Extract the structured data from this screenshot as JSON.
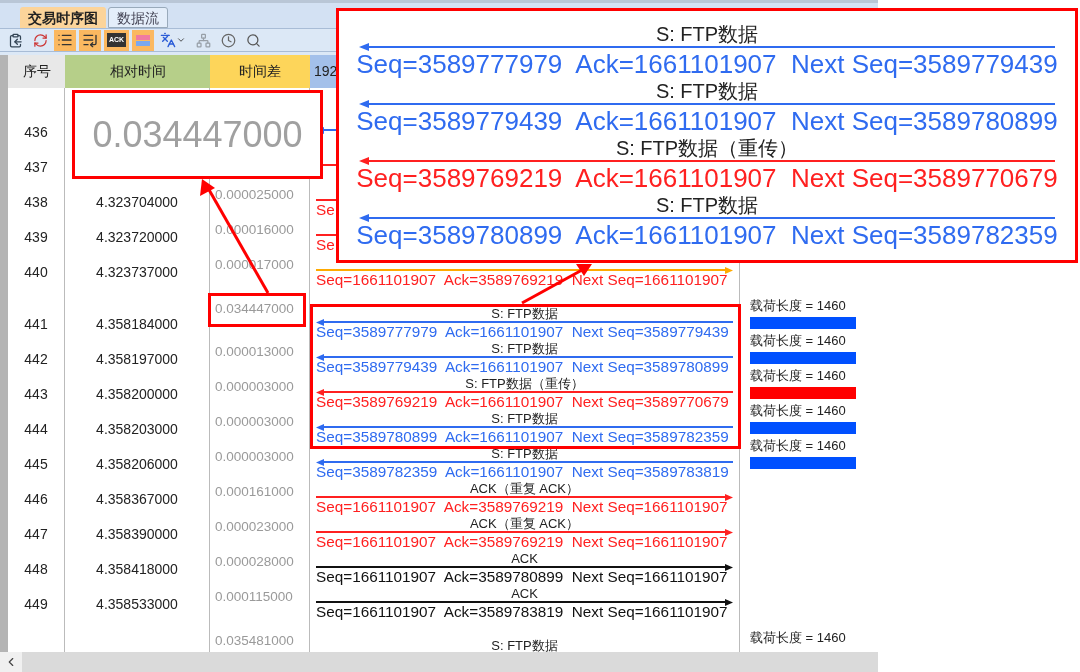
{
  "tabs": [
    {
      "label": "交易时序图",
      "selected": true
    },
    {
      "label": "数据流",
      "selected": false
    }
  ],
  "toolbar": [
    {
      "kind": "copy",
      "on": false,
      "disabled": false
    },
    {
      "kind": "refresh",
      "on": false,
      "disabled": false
    },
    {
      "kind": "list",
      "on": true,
      "disabled": false
    },
    {
      "kind": "list-arrow",
      "on": true,
      "disabled": false
    },
    {
      "kind": "ack",
      "label": "ACK",
      "on": true,
      "disabled": false
    },
    {
      "kind": "color-bars",
      "on": true,
      "disabled": false
    },
    {
      "kind": "language",
      "on": false,
      "disabled": false
    },
    {
      "kind": "tree",
      "on": false,
      "disabled": true
    },
    {
      "kind": "clock",
      "on": false,
      "disabled": false
    },
    {
      "kind": "search",
      "on": false,
      "disabled": false
    }
  ],
  "columns": [
    {
      "label": "序号",
      "color": "#e8e8e8"
    },
    {
      "label": "相对时间",
      "color": "#b6cf89"
    },
    {
      "label": "时间差",
      "color": "#fdd55a"
    },
    {
      "label": "192",
      "color": "#a3c0ea"
    }
  ],
  "rows": [
    {
      "no": "436",
      "flow": {
        "arrow": {
          "kind": "left",
          "color": "#2f6bf0"
        }
      }
    },
    {
      "no": "437",
      "flow": {
        "arrow": {
          "kind": "right",
          "color": "#ff2020"
        }
      }
    },
    {
      "no": "438",
      "time": "4.323704000",
      "delta": "0.000025000",
      "flow": {
        "arrow": {
          "kind": "right",
          "color": "#ff2020"
        },
        "color": "#ff2020",
        "text": "Se"
      }
    },
    {
      "no": "439",
      "time": "4.323720000",
      "delta": "0.000016000",
      "flow": {
        "arrow": {
          "kind": "right",
          "color": "#ff2020"
        },
        "color": "#ff2020",
        "text": "Se"
      }
    },
    {
      "no": "440",
      "time": "4.323737000",
      "delta": "0.000017000",
      "flow": {
        "arrow": {
          "kind": "right",
          "color": "#ffaa00"
        },
        "color": "#ff2020",
        "text": "Seq=1661101907  Ack=3589769219  Next Seq=1661101907"
      }
    },
    {
      "no": "441",
      "time": "4.358184000",
      "delta": "0.034447000",
      "flow": {
        "arrow": {
          "kind": "left",
          "color": "#2f6bf0"
        },
        "color": "#2f6bf0",
        "label": "S: FTP数据",
        "text": "Seq=3589777979  Ack=1661101907  Next Seq=3589779439"
      },
      "payload": {
        "label": "载荷长度 = 1460",
        "color": "#0050ff"
      }
    },
    {
      "no": "442",
      "time": "4.358197000",
      "delta": "0.000013000",
      "flow": {
        "arrow": {
          "kind": "left",
          "color": "#2f6bf0"
        },
        "color": "#2f6bf0",
        "label": "S: FTP数据",
        "text": "Seq=3589779439  Ack=1661101907  Next Seq=3589780899"
      },
      "payload": {
        "label": "载荷长度 = 1460",
        "color": "#0050ff"
      }
    },
    {
      "no": "443",
      "time": "4.358200000",
      "delta": "0.000003000",
      "flow": {
        "arrow": {
          "kind": "left",
          "color": "#ff2020"
        },
        "color": "#ff2020",
        "label": "S: FTP数据（重传）",
        "text": "Seq=3589769219  Ack=1661101907  Next Seq=3589770679"
      },
      "payload": {
        "label": "载荷长度 = 1460",
        "color": "#ff0000"
      }
    },
    {
      "no": "444",
      "time": "4.358203000",
      "delta": "0.000003000",
      "flow": {
        "arrow": {
          "kind": "left",
          "color": "#2f6bf0"
        },
        "color": "#2f6bf0",
        "label": "S: FTP数据",
        "text": "Seq=3589780899  Ack=1661101907  Next Seq=3589782359"
      },
      "payload": {
        "label": "载荷长度 = 1460",
        "color": "#0050ff"
      }
    },
    {
      "no": "445",
      "time": "4.358206000",
      "delta": "0.000003000",
      "flow": {
        "arrow": {
          "kind": "left",
          "color": "#2f6bf0"
        },
        "color": "#2f6bf0",
        "label": "S: FTP数据",
        "text": "Seq=3589782359  Ack=1661101907  Next Seq=3589783819"
      },
      "payload": {
        "label": "载荷长度 = 1460",
        "color": "#0050ff"
      }
    },
    {
      "no": "446",
      "time": "4.358367000",
      "delta": "0.000161000",
      "flow": {
        "arrow": {
          "kind": "right",
          "color": "#ff2020"
        },
        "color": "#ff2020",
        "label": "ACK（重复 ACK）",
        "text": "Seq=1661101907  Ack=3589769219  Next Seq=1661101907"
      }
    },
    {
      "no": "447",
      "time": "4.358390000",
      "delta": "0.000023000",
      "flow": {
        "arrow": {
          "kind": "right",
          "color": "#ff2020"
        },
        "color": "#ff2020",
        "label": "ACK（重复 ACK）",
        "text": "Seq=1661101907  Ack=3589769219  Next Seq=1661101907"
      }
    },
    {
      "no": "448",
      "time": "4.358418000",
      "delta": "0.000028000",
      "flow": {
        "arrow": {
          "kind": "right",
          "color": "#111111"
        },
        "color": "#111111",
        "label": "ACK",
        "text": "Seq=1661101907  Ack=3589780899  Next Seq=1661101907"
      }
    },
    {
      "no": "449",
      "time": "4.358533000",
      "delta": "0.000115000",
      "flow": {
        "arrow": {
          "kind": "right",
          "color": "#111111"
        },
        "color": "#111111",
        "label": "ACK",
        "text": "Seq=1661101907  Ack=3589783819  Next Seq=1661101907"
      }
    },
    {
      "delta": "0.035481000",
      "flow": {
        "label": "S: FTP数据"
      },
      "payload": {
        "label": "载荷长度 = 1460"
      }
    }
  ],
  "delta_callout": {
    "text": "0.034447000"
  },
  "flow_callout": {
    "entries": [
      {
        "label": "S: FTP数据",
        "text": "Seq=3589777979  Ack=1661101907  Next Seq=3589779439",
        "color": "#2f6bf0"
      },
      {
        "label": "S: FTP数据",
        "text": "Seq=3589779439  Ack=1661101907  Next Seq=3589780899",
        "color": "#2f6bf0"
      },
      {
        "label": "S: FTP数据（重传）",
        "text": "Seq=3589769219  Ack=1661101907  Next Seq=3589770679",
        "color": "#ff2020"
      },
      {
        "label": "S: FTP数据",
        "text": "Seq=3589780899  Ack=1661101907  Next Seq=3589782359",
        "color": "#2f6bf0"
      }
    ]
  }
}
